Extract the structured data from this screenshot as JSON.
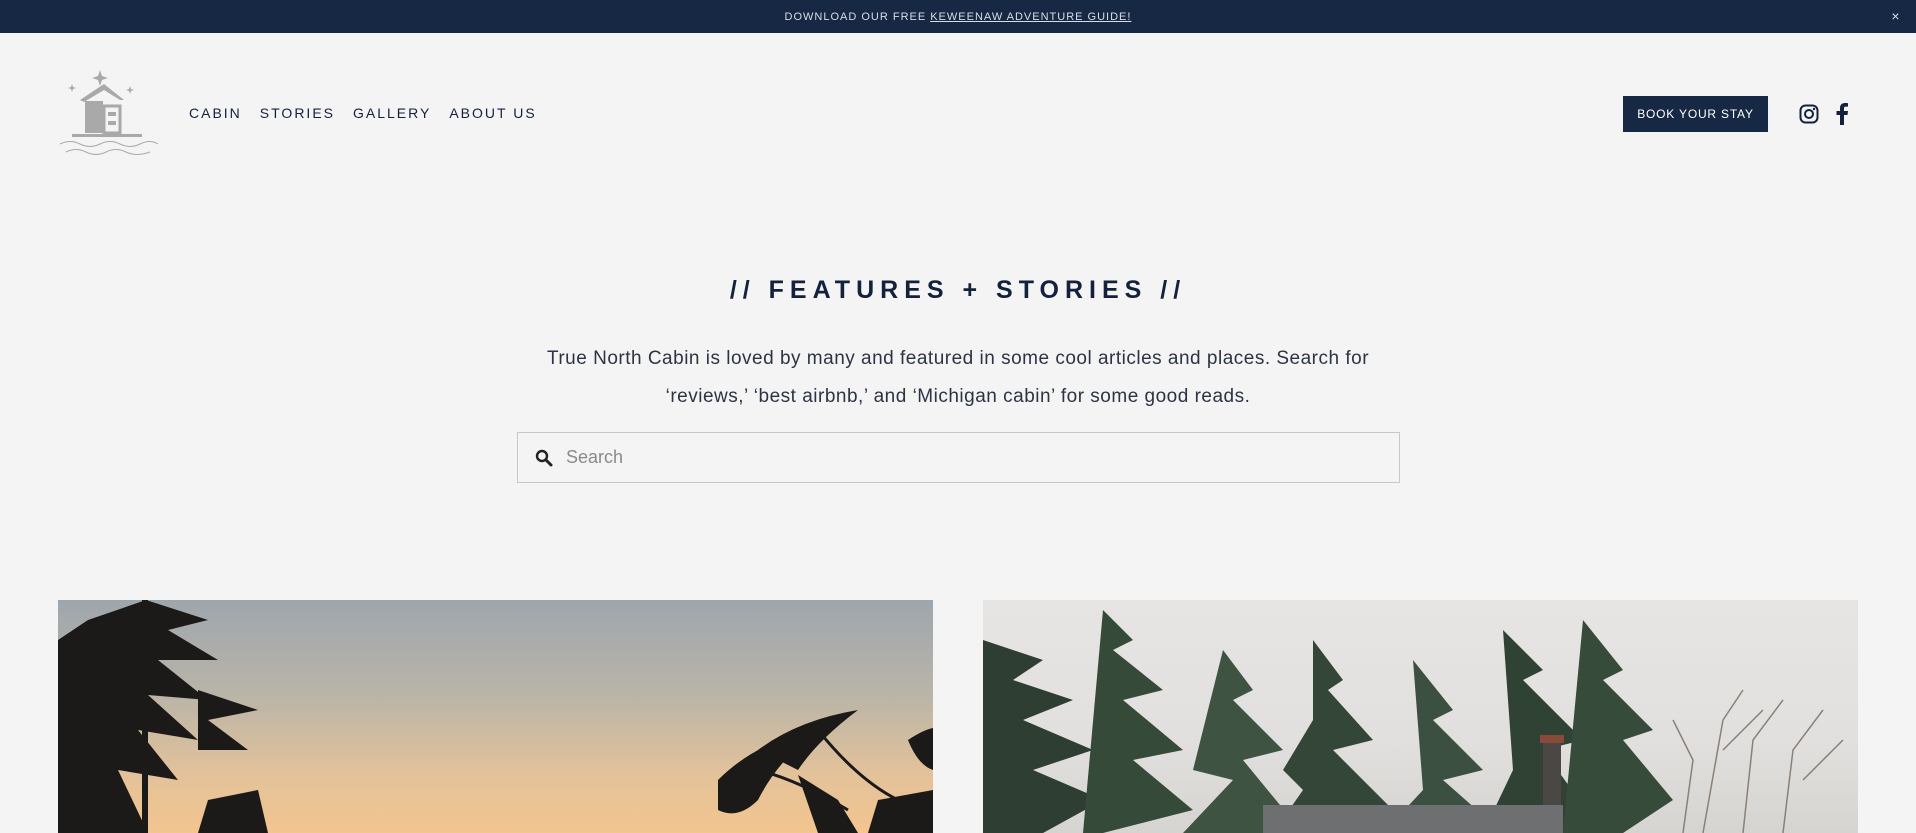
{
  "announcement": {
    "text": "DOWNLOAD OUR FREE",
    "link": "KEWEENAW ADVENTURE GUIDE!",
    "close_label": "×"
  },
  "header": {
    "logo_icon": "cabin-logo-icon",
    "nav": [
      {
        "label": "CABIN"
      },
      {
        "label": "STORIES"
      },
      {
        "label": "GALLERY"
      },
      {
        "label": "ABOUT US"
      }
    ],
    "book_label": "BOOK YOUR STAY",
    "social": [
      "instagram-icon",
      "facebook-icon"
    ]
  },
  "main": {
    "heading": "// FEATURES + STORIES //",
    "description": "True North Cabin is loved by many and featured in some cool articles and places. Search for ‘reviews,’ ‘best airbnb,’ and ‘Michigan cabin’ for some good reads.",
    "search": {
      "placeholder": "Search",
      "value": ""
    }
  },
  "colors": {
    "navy": "#172845",
    "background": "#f4f4f4",
    "text": "#14213d"
  }
}
